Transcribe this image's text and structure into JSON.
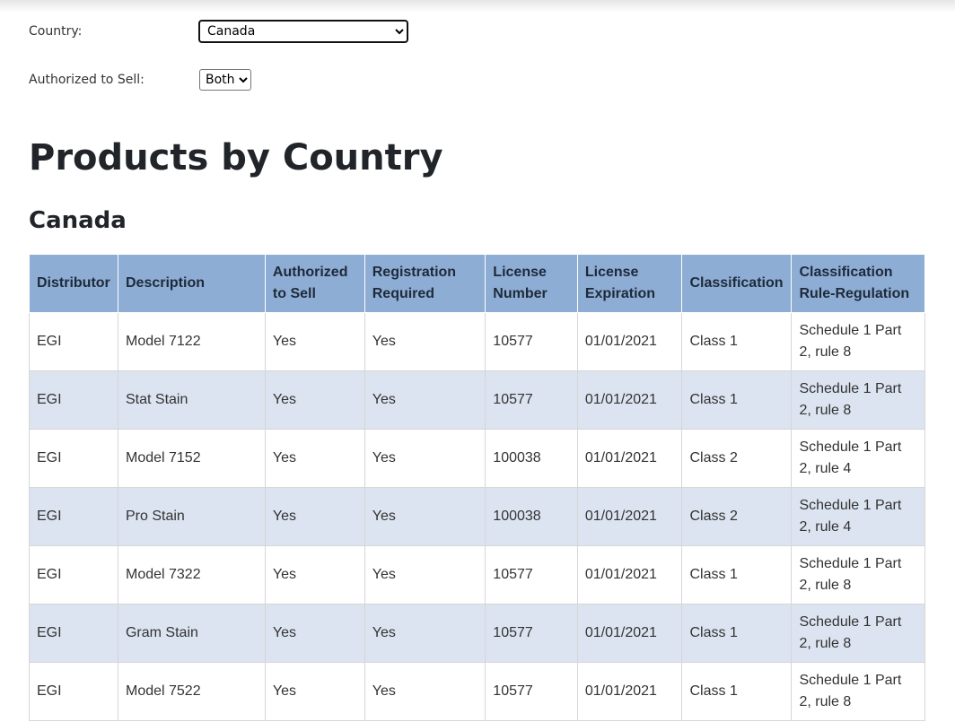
{
  "filters": {
    "country_label": "Country:",
    "country_value": "Canada",
    "authorized_label": "Authorized to Sell:",
    "authorized_value": "Both"
  },
  "page_title": "Products by Country",
  "country_heading": "Canada",
  "table": {
    "headers": [
      "Distributor",
      "Description",
      "Authorized to Sell",
      "Registration Required",
      "License Number",
      "License Expiration",
      "Classification",
      "Classification Rule-Regulation"
    ],
    "rows": [
      [
        "EGI",
        "Model 7122",
        "Yes",
        "Yes",
        "10577",
        "01/01/2021",
        "Class 1",
        "Schedule 1 Part 2, rule 8"
      ],
      [
        "EGI",
        "Stat Stain",
        "Yes",
        "Yes",
        "10577",
        "01/01/2021",
        "Class 1",
        "Schedule 1 Part 2, rule 8"
      ],
      [
        "EGI",
        "Model 7152",
        "Yes",
        "Yes",
        "100038",
        "01/01/2021",
        "Class 2",
        "Schedule 1 Part 2, rule 4"
      ],
      [
        "EGI",
        "Pro Stain",
        "Yes",
        "Yes",
        "100038",
        "01/01/2021",
        "Class 2",
        "Schedule 1 Part 2, rule 4"
      ],
      [
        "EGI",
        "Model 7322",
        "Yes",
        "Yes",
        "10577",
        "01/01/2021",
        "Class 1",
        "Schedule 1 Part 2, rule 8"
      ],
      [
        "EGI",
        "Gram Stain",
        "Yes",
        "Yes",
        "10577",
        "01/01/2021",
        "Class 1",
        "Schedule 1 Part 2, rule 8"
      ],
      [
        "EGI",
        "Model 7522",
        "Yes",
        "Yes",
        "10577",
        "01/01/2021",
        "Class 1",
        "Schedule 1 Part 2, rule 8"
      ]
    ]
  },
  "colors": {
    "header_bg": "#8eadd4",
    "alt_row_bg": "#dbe4f0"
  }
}
